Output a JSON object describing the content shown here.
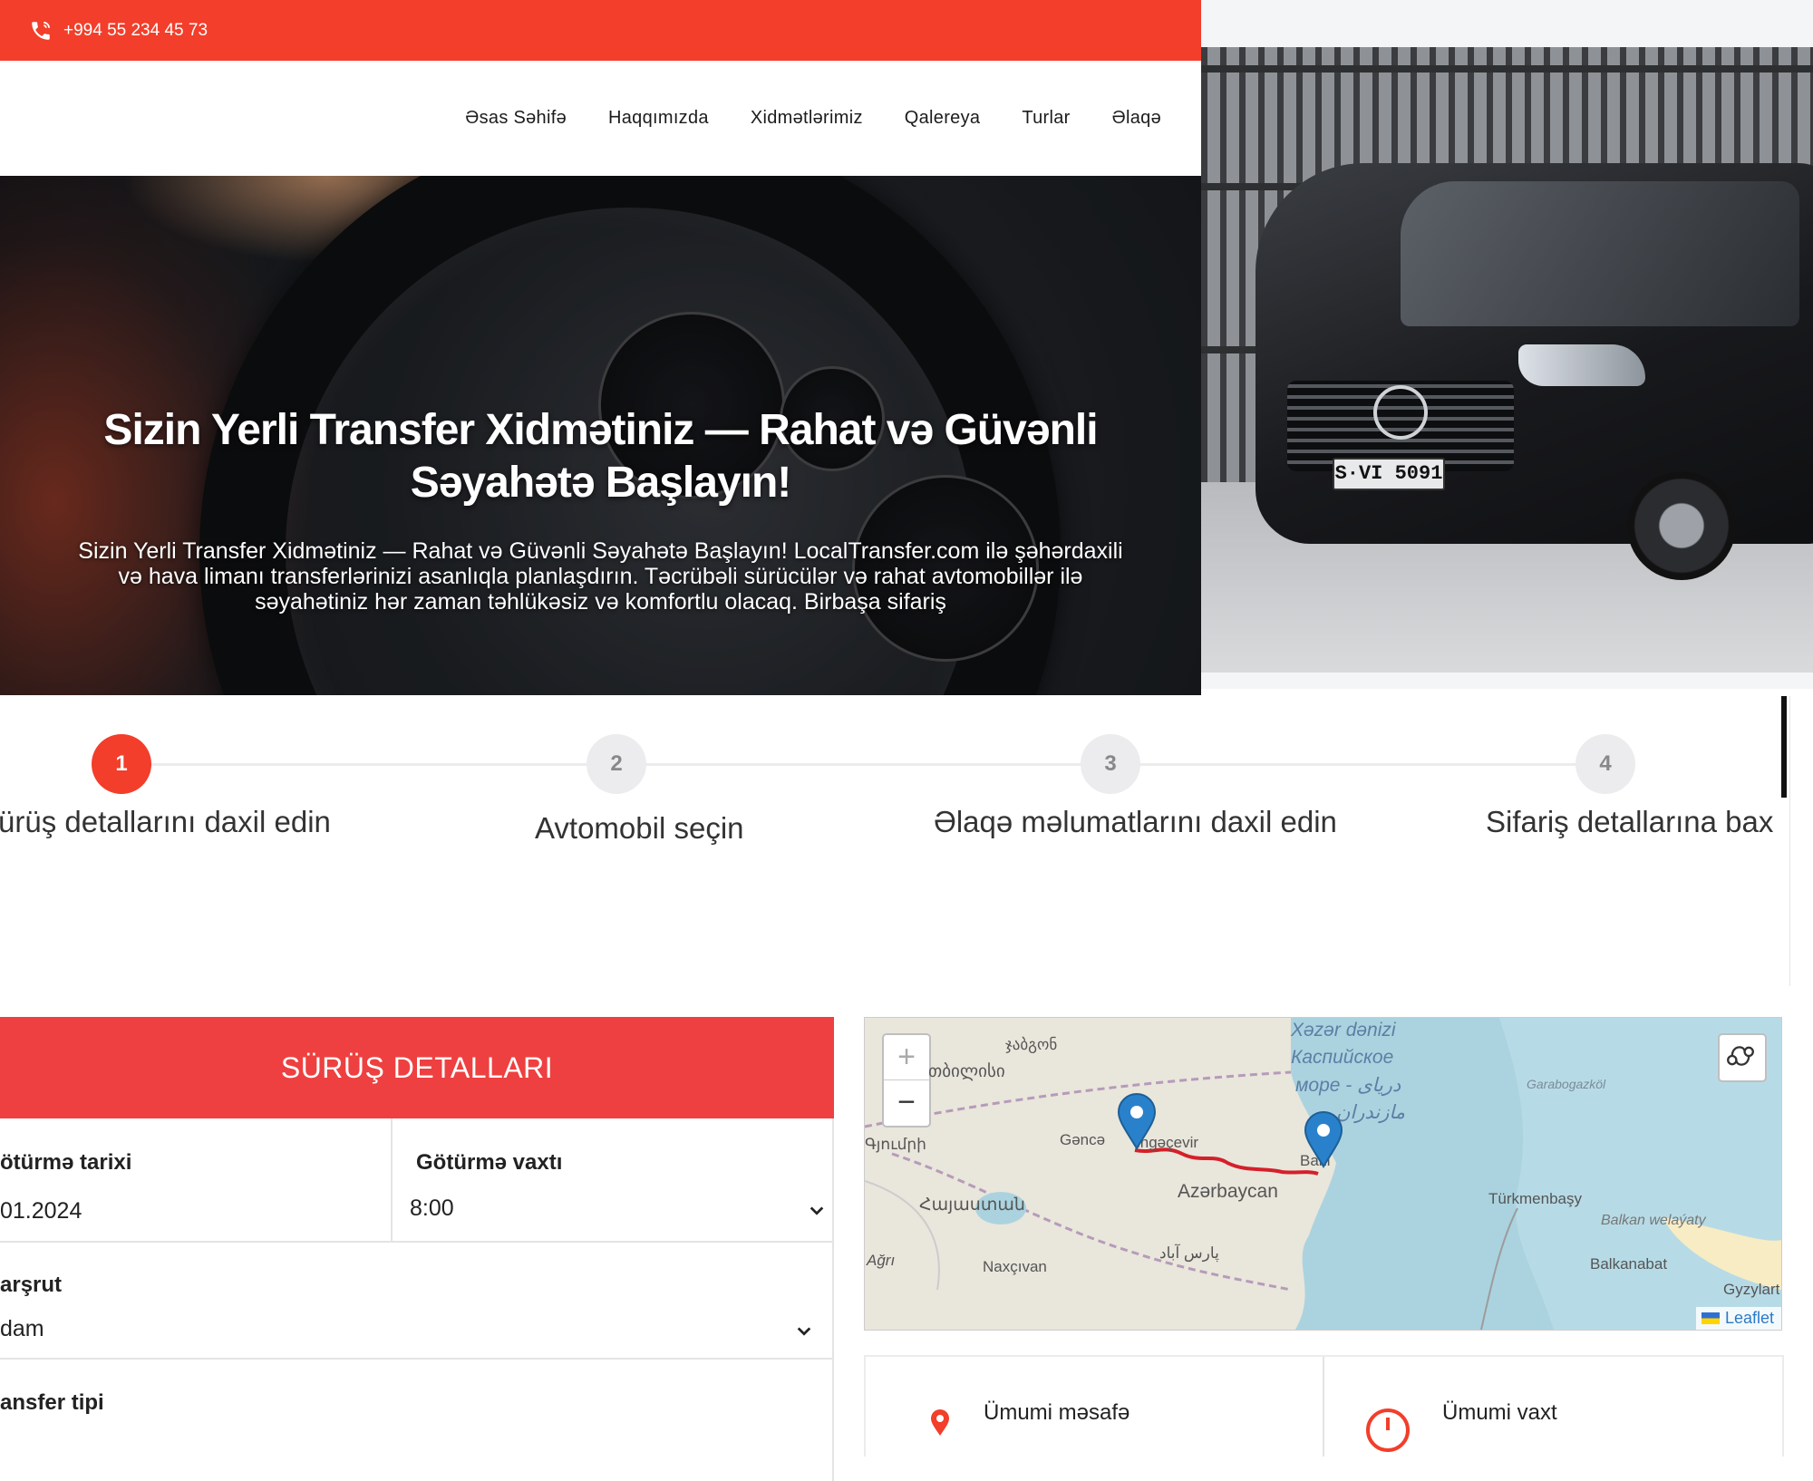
{
  "topbar": {
    "phone": "+994 55 234 45 73"
  },
  "nav": {
    "items": [
      "Əsas Səhifə",
      "Haqqımızda",
      "Xidmətlərimiz",
      "Qalereya",
      "Turlar",
      "Əlaqə"
    ]
  },
  "hero": {
    "title_line1": "Sizin Yerli Transfer Xidmətiniz — Rahat və Güvənli",
    "title_line2": "Səyahətə Başlayın!",
    "sub_line1": "Sizin Yerli Transfer Xidmətiniz — Rahat və Güvənli Səyahətə Başlayın! LocalTransfer.com ilə şəhərdaxili",
    "sub_line2": "və hava limanı transferlərinizi asanlıqla planlaşdırın. Təcrübəli sürücülər və rahat avtomobillər ilə",
    "sub_line3": "səyahətiniz hər zaman təhlükəsiz və komfortlu olacaq. Birbaşa sifariş"
  },
  "van": {
    "plate": "S·VI 5091"
  },
  "steps": [
    {
      "number": "1",
      "label": "ürüş detallarını daxil edin",
      "active": true
    },
    {
      "number": "2",
      "label": "Avtomobil seçin",
      "active": false
    },
    {
      "number": "3",
      "label": "Əlaqə məlumatlarını daxil edin",
      "active": false
    },
    {
      "number": "4",
      "label": "Sifariş detallarına bax",
      "active": false
    }
  ],
  "form": {
    "title": "SÜRÜŞ DETALLARI",
    "date_label": "ötürmə tarixi",
    "date_value": "01.2024",
    "time_label": "Götürmə vaxtı",
    "time_value": "8:00",
    "route_label": "arşrut",
    "route_value": "dam",
    "transfer_label": "ansfer tipi"
  },
  "map": {
    "zoom_in": "+",
    "zoom_out": "−",
    "labels": {
      "tbilisi": "თბილისი",
      "jabgon": "ჯაბგონ",
      "gyumri": "Գյումրի",
      "ganca": "Gəncə",
      "mingacevir": "ingəçevir",
      "azerbaycan": "Azərbaycan",
      "hayastan": "Հայաստան",
      "agri": "Ağrı",
      "naxcivan": "Naxçıvan",
      "pars_abad": "پارس آباد",
      "baki": "Bakı",
      "sea1": "Xəzər dənizi",
      "sea2": "Каспийское",
      "sea3": "море - دریای",
      "sea4": "مازندران",
      "garabogazkol": "Garabogazköl",
      "turkmenbasy": "Türkmenbaşy",
      "balkan": "Balkan welaýaty",
      "balkanabat": "Balkanabat",
      "gyzylar": "Gyzylart"
    },
    "attribution": "Leaflet"
  },
  "stats": {
    "distance_label": "Ümumi məsafə",
    "time_label": "Ümumi vaxt"
  },
  "colors": {
    "accent": "#f23e2a",
    "form_header": "#ee4040",
    "route_line": "#d4202a",
    "marker": "#2a81cb"
  }
}
